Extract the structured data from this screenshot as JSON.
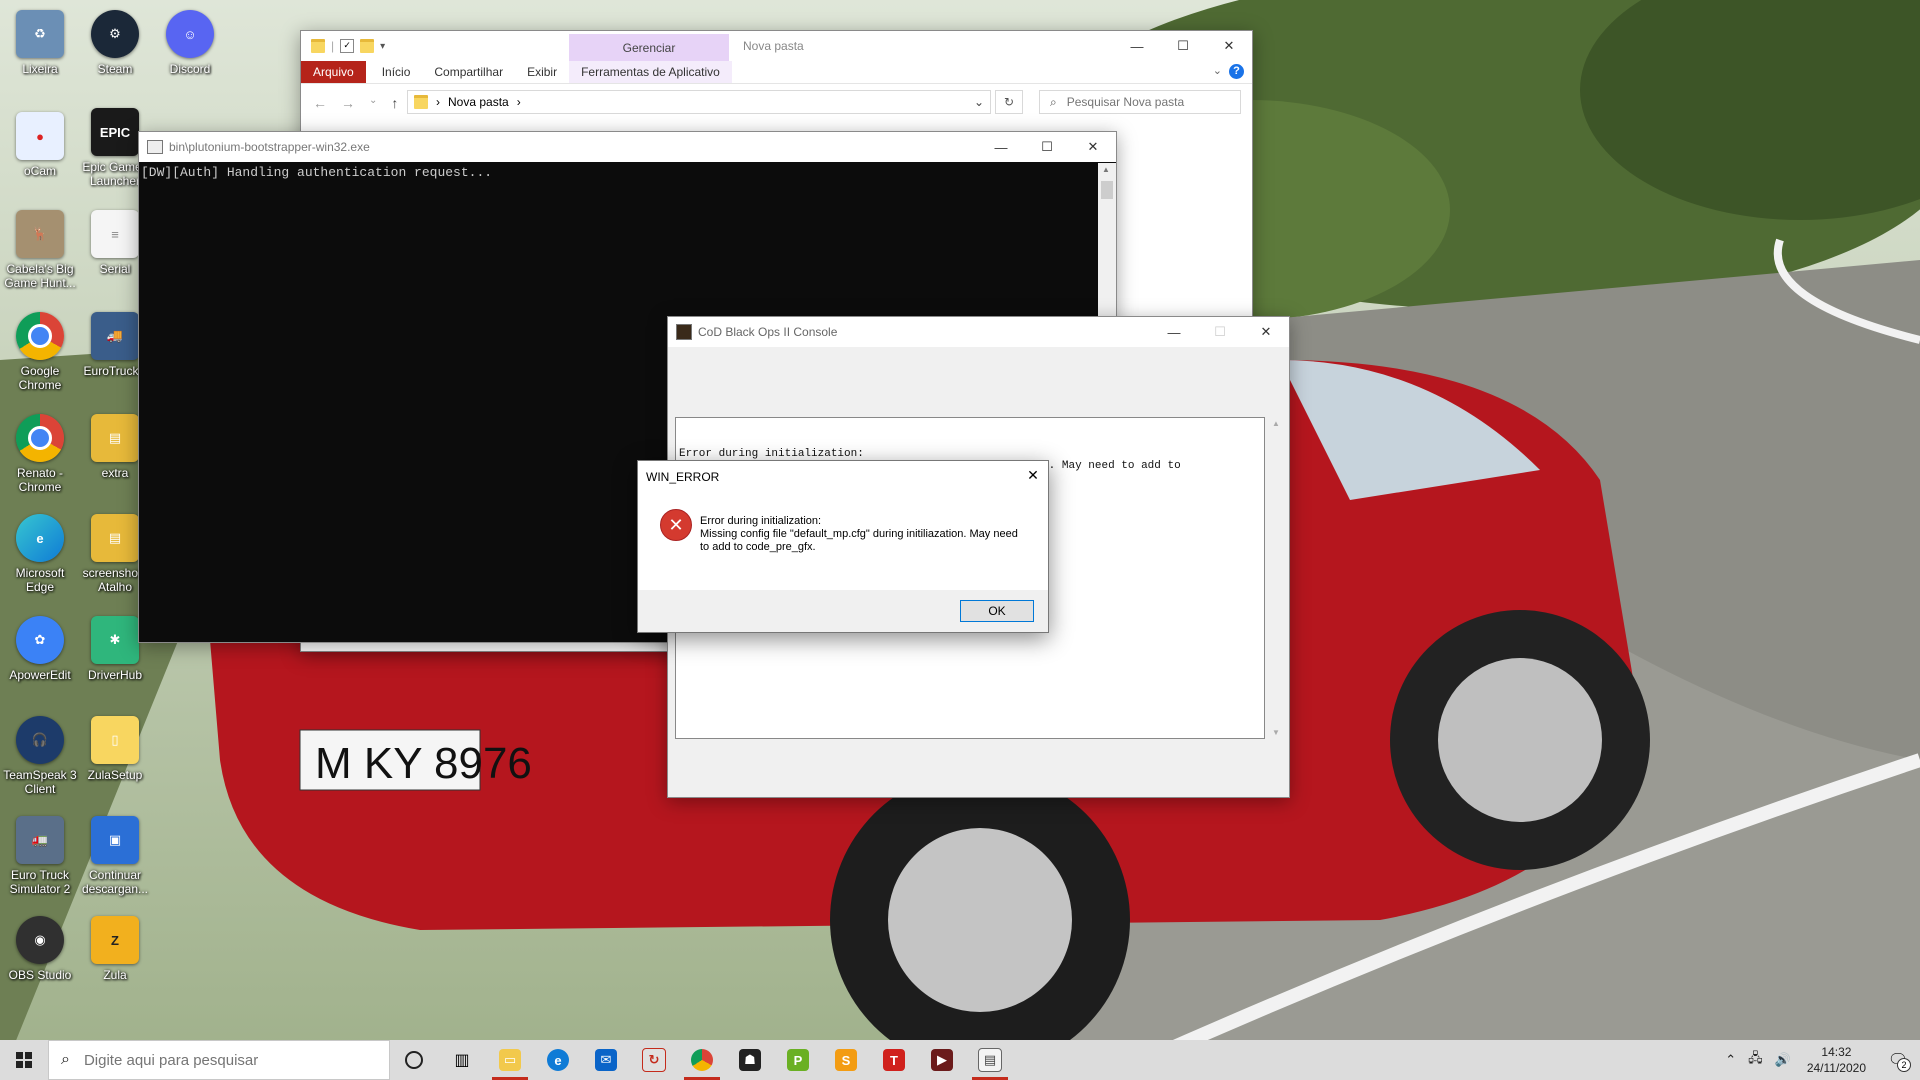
{
  "desktop": {
    "icons": [
      {
        "label": "Lixeira",
        "color": "#6b8fb5",
        "glyph": ""
      },
      {
        "label": "Steam",
        "color": "#1b2838",
        "glyph": ""
      },
      {
        "label": "Discord",
        "color": "#5865f2",
        "glyph": ""
      },
      {
        "label": "oCam",
        "color": "#e8f0ff",
        "glyph": ""
      },
      {
        "label": "Epic Games Launcher",
        "color": "#1a1a1a",
        "glyph": "EPIC"
      },
      {
        "label": "Cabela's Big Game Hunt...",
        "color": "#a59070",
        "glyph": ""
      },
      {
        "label": "Serial",
        "color": "#f5f5f5",
        "glyph": ""
      },
      {
        "label": "Google Chrome",
        "color": "#ffffff",
        "glyph": ""
      },
      {
        "label": "EuroTruckS",
        "color": "#3a5d8a",
        "glyph": ""
      },
      {
        "label": "Renato - Chrome",
        "color": "#ffffff",
        "glyph": ""
      },
      {
        "label": "extra",
        "color": "#e7b93a",
        "glyph": ""
      },
      {
        "label": "Microsoft Edge",
        "color": "#0f7bd6",
        "glyph": ""
      },
      {
        "label": "screenshots Atalho",
        "color": "#e7b93a",
        "glyph": ""
      },
      {
        "label": "ApowerEdit",
        "color": "#3b82f6",
        "glyph": ""
      },
      {
        "label": "DriverHub",
        "color": "#2fb67c",
        "glyph": ""
      },
      {
        "label": "TeamSpeak 3 Client",
        "color": "#1d3b6a",
        "glyph": ""
      },
      {
        "label": "ZulaSetup",
        "color": "#f8d660",
        "glyph": ""
      },
      {
        "label": "Euro Truck Simulator 2",
        "color": "#5a6f89",
        "glyph": ""
      },
      {
        "label": "Continuar descargan...",
        "color": "#2b6fd6",
        "glyph": ""
      },
      {
        "label": "OBS Studio",
        "color": "#303030",
        "glyph": ""
      },
      {
        "label": "Zula",
        "color": "#f2b01e",
        "glyph": "Z"
      }
    ]
  },
  "explorer": {
    "title": "Nova pasta",
    "context_group": "Gerenciar",
    "tabs": {
      "file": "Arquivo",
      "home": "Início",
      "share": "Compartilhar",
      "view": "Exibir",
      "app_tools": "Ferramentas de Aplicativo"
    },
    "address": "Nova pasta",
    "search_placeholder": "Pesquisar Nova pasta"
  },
  "console": {
    "title": "bin\\plutonium-bootstrapper-win32.exe",
    "output": "[DW][Auth] Handling authentication request..."
  },
  "cod_console": {
    "title": "CoD Black Ops II Console",
    "log_line1": "Error during initialization:",
    "log_line2": "                                                   ation. May need to add to"
  },
  "error_dialog": {
    "title": "WIN_ERROR",
    "message_line1": "Error during initialization:",
    "message_line2": "Missing config file \"default_mp.cfg\" during initiliazation. May need to add to code_pre_gfx.",
    "ok_label": "OK"
  },
  "taskbar": {
    "search_placeholder": "Digite aqui para pesquisar",
    "time": "14:32",
    "date": "24/11/2020",
    "notification_count": "2",
    "accent": "#c42b1c"
  }
}
